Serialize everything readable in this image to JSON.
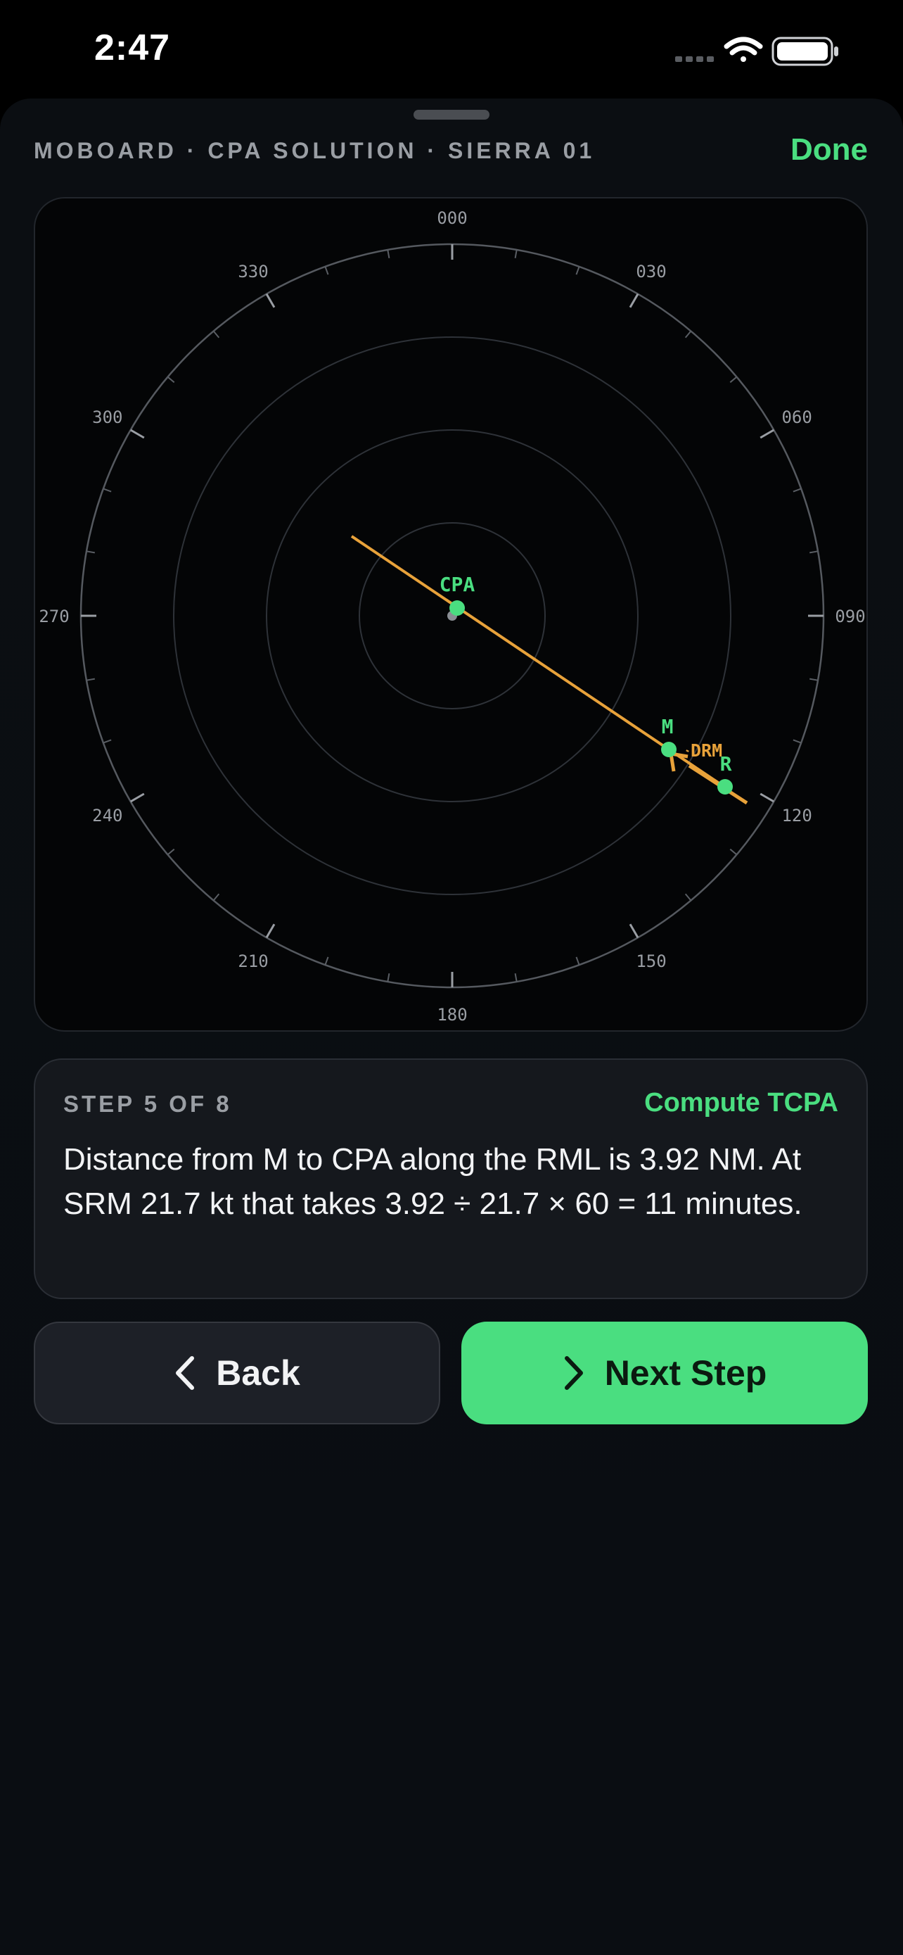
{
  "status_bar": {
    "time": "2:47"
  },
  "header": {
    "title": "MOBOARD · CPA SOLUTION · SIERRA 01",
    "done_label": "Done"
  },
  "plot": {
    "bearing_labels": [
      "000",
      "030",
      "060",
      "090",
      "120",
      "150",
      "180",
      "210",
      "240",
      "270",
      "300",
      "330"
    ],
    "point_labels": {
      "cpa": "CPA",
      "m": "M",
      "r": "R",
      "drm": "DRM"
    },
    "colors": {
      "accent": "#4ade80",
      "rml": "#e8a23a",
      "rings": "#2e3238",
      "outer_ring": "#55595f"
    }
  },
  "step": {
    "counter": "STEP 5 OF 8",
    "action": "Compute TCPA",
    "text": "Distance from M to CPA along the RML is 3.92 NM. At SRM 21.7 kt that takes 3.92 ÷ 21.7 × 60 = 11 minutes."
  },
  "buttons": {
    "back_label": "Back",
    "next_label": "Next Step"
  },
  "icons": {
    "signal": "cellular-signal-icon",
    "wifi": "wifi-icon",
    "battery": "battery-icon",
    "back": "chevron-left-icon",
    "next": "chevron-right-icon"
  }
}
